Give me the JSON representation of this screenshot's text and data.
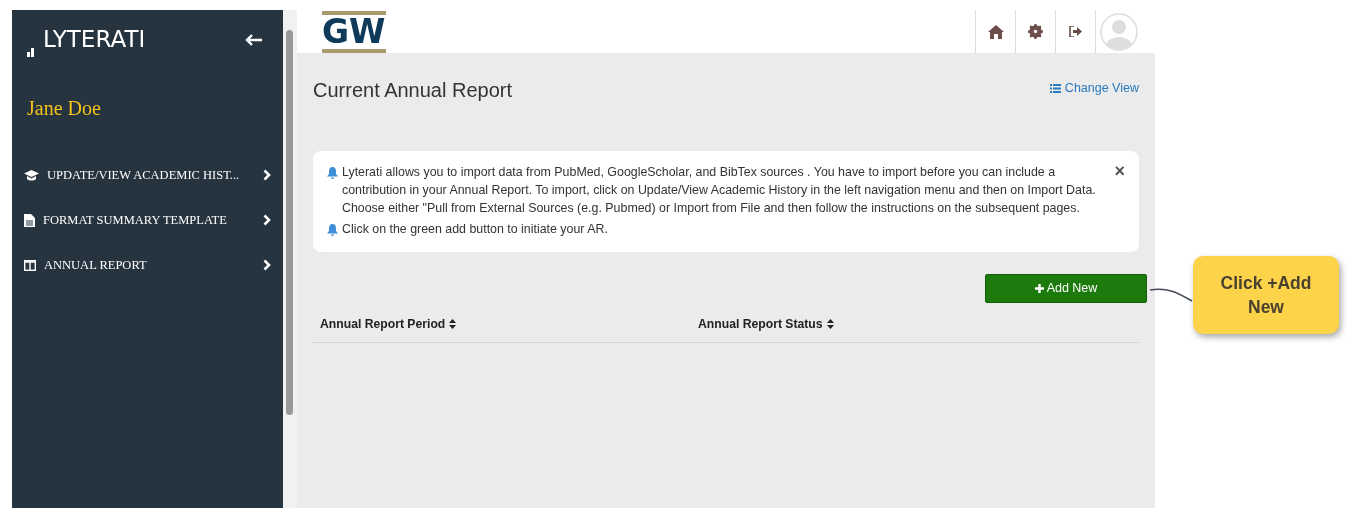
{
  "sidebar": {
    "logo": "LYTERATI",
    "user_name": "Jane Doe",
    "items": [
      {
        "label": "UPDATE/VIEW ACADEMIC HIST..."
      },
      {
        "label": "FORMAT SUMMARY TEMPLATE"
      },
      {
        "label": "ANNUAL REPORT"
      }
    ]
  },
  "header": {
    "logo": "GW"
  },
  "page": {
    "title": "Current Annual Report",
    "change_view": "Change View",
    "notice": {
      "lines": [
        "Lyterati allows you to import data from PubMed, GoogleScholar, and BibTex sources . You have to import before you can include a contribution in your Annual Report. To import, click on Update/View Academic History in the left navigation menu and then on Import Data. Choose either \"Pull from External Sources (e.g. Pubmed) or Import from File and then follow the instructions on the subsequent pages.",
        "Click on the green add button to initiate your AR."
      ],
      "close": "×"
    },
    "add_button": "Add New",
    "table": {
      "columns": [
        "Annual Report Period",
        "Annual Report Status"
      ]
    }
  },
  "callout": {
    "text": "Click +Add New"
  }
}
